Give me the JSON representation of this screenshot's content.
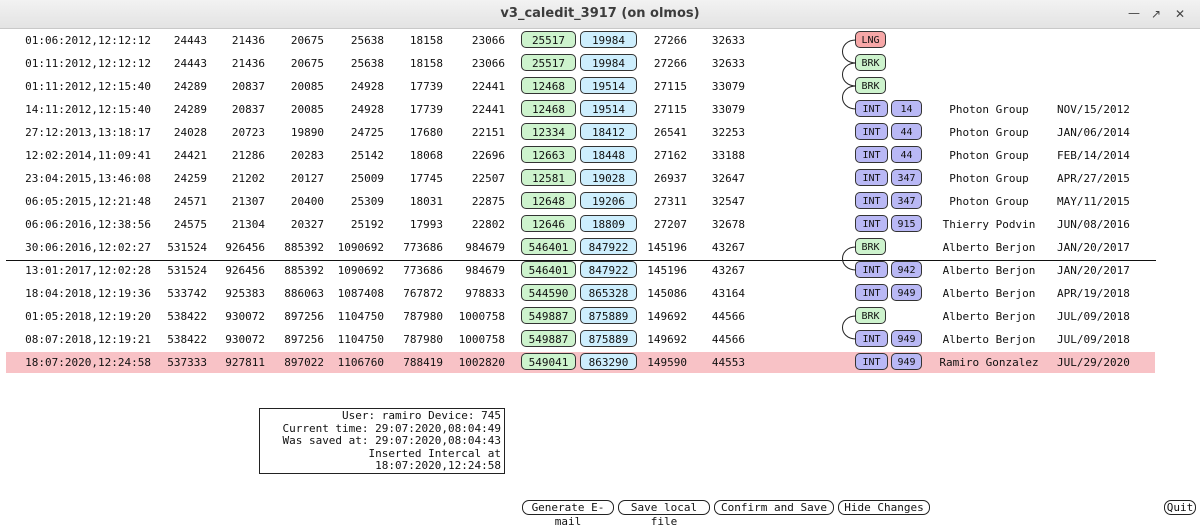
{
  "window": {
    "title": "v3_caledit_3917 (on olmos)"
  },
  "rows": [
    {
      "datetime": "01:06:2012,12:12:12",
      "v1": "24443",
      "v2": "21436",
      "v3": "20675",
      "v4": "25638",
      "v5": "18158",
      "v6": "23066",
      "g": "25517",
      "c": "19984",
      "v7": "27266",
      "v8": "32633",
      "flag": "LNG",
      "id": "",
      "user": "",
      "date": ""
    },
    {
      "datetime": "01:11:2012,12:12:12",
      "v1": "24443",
      "v2": "21436",
      "v3": "20675",
      "v4": "25638",
      "v5": "18158",
      "v6": "23066",
      "g": "25517",
      "c": "19984",
      "v7": "27266",
      "v8": "32633",
      "flag": "BRK",
      "id": "",
      "user": "",
      "date": ""
    },
    {
      "datetime": "01:11:2012,12:15:40",
      "v1": "24289",
      "v2": "20837",
      "v3": "20085",
      "v4": "24928",
      "v5": "17739",
      "v6": "22441",
      "g": "12468",
      "c": "19514",
      "v7": "27115",
      "v8": "33079",
      "flag": "BRK",
      "id": "",
      "user": "",
      "date": ""
    },
    {
      "datetime": "14:11:2012,12:15:40",
      "v1": "24289",
      "v2": "20837",
      "v3": "20085",
      "v4": "24928",
      "v5": "17739",
      "v6": "22441",
      "g": "12468",
      "c": "19514",
      "v7": "27115",
      "v8": "33079",
      "flag": "INT",
      "id": "14",
      "user": "Photon Group",
      "date": "NOV/15/2012"
    },
    {
      "datetime": "27:12:2013,13:18:17",
      "v1": "24028",
      "v2": "20723",
      "v3": "19890",
      "v4": "24725",
      "v5": "17680",
      "v6": "22151",
      "g": "12334",
      "c": "18412",
      "v7": "26541",
      "v8": "32253",
      "flag": "INT",
      "id": "44",
      "user": "Photon Group",
      "date": "JAN/06/2014"
    },
    {
      "datetime": "12:02:2014,11:09:41",
      "v1": "24421",
      "v2": "21286",
      "v3": "20283",
      "v4": "25142",
      "v5": "18068",
      "v6": "22696",
      "g": "12663",
      "c": "18448",
      "v7": "27162",
      "v8": "33188",
      "flag": "INT",
      "id": "44",
      "user": "Photon Group",
      "date": "FEB/14/2014"
    },
    {
      "datetime": "23:04:2015,13:46:08",
      "v1": "24259",
      "v2": "21202",
      "v3": "20127",
      "v4": "25009",
      "v5": "17745",
      "v6": "22507",
      "g": "12581",
      "c": "19028",
      "v7": "26937",
      "v8": "32647",
      "flag": "INT",
      "id": "347",
      "user": "Photon Group",
      "date": "APR/27/2015"
    },
    {
      "datetime": "06:05:2015,12:21:48",
      "v1": "24571",
      "v2": "21307",
      "v3": "20400",
      "v4": "25309",
      "v5": "18031",
      "v6": "22875",
      "g": "12648",
      "c": "19206",
      "v7": "27311",
      "v8": "32547",
      "flag": "INT",
      "id": "347",
      "user": "Photon Group",
      "date": "MAY/11/2015"
    },
    {
      "datetime": "06:06:2016,12:38:56",
      "v1": "24575",
      "v2": "21304",
      "v3": "20327",
      "v4": "25192",
      "v5": "17993",
      "v6": "22802",
      "g": "12646",
      "c": "18809",
      "v7": "27207",
      "v8": "32678",
      "flag": "INT",
      "id": "915",
      "user": "Thierry Podvin",
      "date": "JUN/08/2016"
    },
    {
      "datetime": "30:06:2016,12:02:27",
      "v1": "531524",
      "v2": "926456",
      "v3": "885392",
      "v4": "1090692",
      "v5": "773686",
      "v6": "984679",
      "g": "546401",
      "c": "847922",
      "v7": "145196",
      "v8": "43267",
      "flag": "BRK",
      "id": "",
      "user": "Alberto Berjon",
      "date": "JAN/20/2017"
    },
    {
      "datetime": "13:01:2017,12:02:28",
      "v1": "531524",
      "v2": "926456",
      "v3": "885392",
      "v4": "1090692",
      "v5": "773686",
      "v6": "984679",
      "g": "546401",
      "c": "847922",
      "v7": "145196",
      "v8": "43267",
      "flag": "INT",
      "id": "942",
      "user": "Alberto Berjon",
      "date": "JAN/20/2017"
    },
    {
      "datetime": "18:04:2018,12:19:36",
      "v1": "533742",
      "v2": "925383",
      "v3": "886063",
      "v4": "1087408",
      "v5": "767872",
      "v6": "978833",
      "g": "544590",
      "c": "865328",
      "v7": "145086",
      "v8": "43164",
      "flag": "INT",
      "id": "949",
      "user": "Alberto Berjon",
      "date": "APR/19/2018"
    },
    {
      "datetime": "01:05:2018,12:19:20",
      "v1": "538422",
      "v2": "930072",
      "v3": "897256",
      "v4": "1104750",
      "v5": "787980",
      "v6": "1000758",
      "g": "549887",
      "c": "875889",
      "v7": "149692",
      "v8": "44566",
      "flag": "BRK",
      "id": "",
      "user": "Alberto Berjon",
      "date": "JUL/09/2018"
    },
    {
      "datetime": "08:07:2018,12:19:21",
      "v1": "538422",
      "v2": "930072",
      "v3": "897256",
      "v4": "1104750",
      "v5": "787980",
      "v6": "1000758",
      "g": "549887",
      "c": "875889",
      "v7": "149692",
      "v8": "44566",
      "flag": "INT",
      "id": "949",
      "user": "Alberto Berjon",
      "date": "JUL/09/2018"
    },
    {
      "datetime": "18:07:2020,12:24:58",
      "v1": "537333",
      "v2": "927811",
      "v3": "897022",
      "v4": "1106760",
      "v5": "788419",
      "v6": "1002820",
      "g": "549041",
      "c": "863290",
      "v7": "149590",
      "v8": "44553",
      "flag": "INT",
      "id": "949",
      "user": "Ramiro Gonzalez",
      "date": "JUL/29/2020",
      "highlight": true
    }
  ],
  "info": {
    "user_line": "User: ramiro Device: 745",
    "current_time": "Current time: 29:07:2020,08:04:49",
    "saved_at": "Was saved at: 29:07:2020,08:04:43",
    "inserted": "Inserted Intercal at 18:07:2020,12:24:58"
  },
  "buttons": {
    "email": "Generate E-mail",
    "save_local": "Save local file",
    "confirm": "Confirm and Save",
    "hide": "Hide Changes",
    "quit": "Quit"
  }
}
